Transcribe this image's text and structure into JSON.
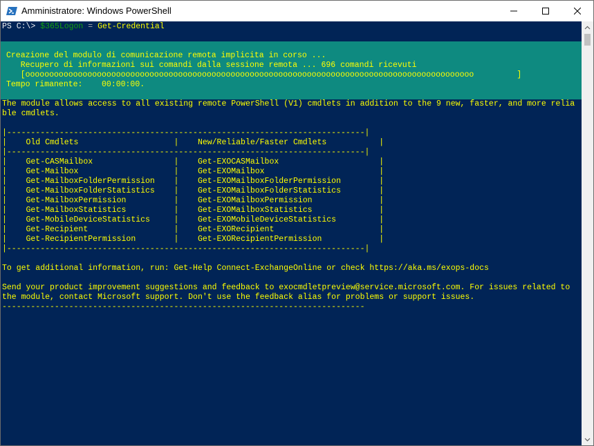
{
  "window": {
    "title": "Amministratore: Windows PowerShell",
    "icon": "powershell-icon",
    "controls": [
      "minimize-icon",
      "maximize-icon",
      "close-icon"
    ]
  },
  "colors": {
    "console_bg": "#012456",
    "progress_bg": "#0e8a80",
    "yellow_text": "#ffff00",
    "default_text": "#eeedf0"
  },
  "prompt": {
    "ps": "PS C:\\>",
    "variable": "$365Logon",
    "operator": "=",
    "command": "Get-Credential"
  },
  "progress": {
    "activity": "Creazione del modulo di comunicazione remota implicita in corso ...",
    "status": "   Recupero di informazioni sui comandi dalla sessione remota ... 696 comandi ricevuti",
    "bar": "   [oooooooooooooooooooooooooooooooooooooooooooooooooooooooooooooooooooooooooooooooooooooooooooooo         ]",
    "time": "Tempo rimanente:    00:00:00."
  },
  "output": {
    "intro_1": "The module allows access to all existing remote PowerShell (V1) cmdlets in addition to the 9 new, faster, and more relia",
    "intro_2": "ble cmdlets.",
    "table_top": "|---------------------------------------------------------------------------|",
    "header": "|    Old Cmdlets                    |    New/Reliable/Faster Cmdlets           |",
    "table_sep": "|---------------------------------------------------------------------------|",
    "rows": [
      "|    Get-CASMailbox                 |    Get-EXOCASMailbox                     |",
      "|    Get-Mailbox                    |    Get-EXOMailbox                        |",
      "|    Get-MailboxFolderPermission    |    Get-EXOMailboxFolderPermission        |",
      "|    Get-MailboxFolderStatistics    |    Get-EXOMailboxFolderStatistics        |",
      "|    Get-MailboxPermission          |    Get-EXOMailboxPermission              |",
      "|    Get-MailboxStatistics          |    Get-EXOMailboxStatistics              |",
      "|    Get-MobileDeviceStatistics     |    Get-EXOMobileDeviceStatistics         |",
      "|    Get-Recipient                  |    Get-EXORecipient                      |",
      "|    Get-RecipientPermission        |    Get-EXORecipientPermission            |"
    ],
    "table_bottom": "|---------------------------------------------------------------------------|",
    "help": "To get additional information, run: Get-Help Connect-ExchangeOnline or check https://aka.ms/exops-docs",
    "feedback_1": "Send your product improvement suggestions and feedback to exocmdletpreview@service.microsoft.com. For issues related to",
    "feedback_2": "the module, contact Microsoft support. Don't use the feedback alias for problems or support issues.",
    "end_rule": "----------------------------------------------------------------------------"
  },
  "scrollbar": {
    "up": "scroll-up-arrow-icon",
    "down": "scroll-down-arrow-icon"
  }
}
